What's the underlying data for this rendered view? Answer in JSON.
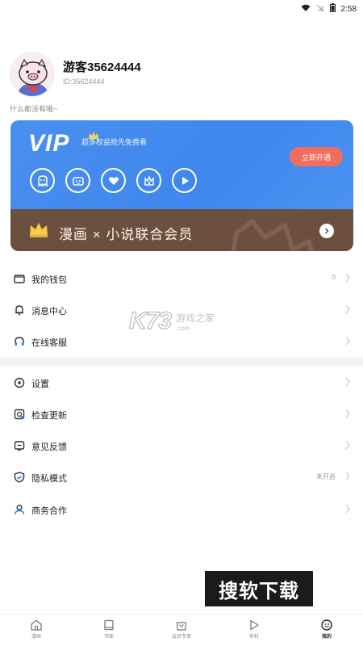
{
  "status_bar": {
    "time": "2:58"
  },
  "profile": {
    "username": "游客35624444",
    "user_id": "ID:35624444",
    "bio": "什么都没有哦~"
  },
  "vip": {
    "logo_text": "VIP",
    "description": "超多权益抢先免费看",
    "open_button": "立即开通",
    "perk_icons": [
      "ghost-icon",
      "id-card-icon",
      "heart-icon",
      "crown-cup-icon",
      "play-icon"
    ]
  },
  "union": {
    "title": "漫画 × 小说联合会员"
  },
  "menu": {
    "group1": [
      {
        "label": "我的钱包",
        "extra": "0",
        "icon": "wallet-icon"
      },
      {
        "label": "消息中心",
        "extra": "",
        "icon": "bell-icon"
      },
      {
        "label": "在线客服",
        "extra": "",
        "icon": "headset-icon"
      }
    ],
    "group2": [
      {
        "label": "设置",
        "extra": "",
        "icon": "settings-icon"
      },
      {
        "label": "检查更新",
        "extra": "",
        "icon": "update-icon"
      },
      {
        "label": "意见反馈",
        "extra": "",
        "icon": "feedback-icon"
      },
      {
        "label": "隐私模式",
        "extra": "未开启",
        "icon": "shield-icon"
      },
      {
        "label": "商务合作",
        "extra": "",
        "icon": "person-icon"
      }
    ]
  },
  "watermark": {
    "logo": "K73",
    "name": "游戏之家",
    "url": ".com"
  },
  "overlay_badge": "搜软下载",
  "tabs": [
    {
      "label": "漫画",
      "icon": "home-icon"
    },
    {
      "label": "书架",
      "icon": "bookshelf-icon"
    },
    {
      "label": "会员专享",
      "icon": "vip-bag-icon"
    },
    {
      "label": "有料",
      "icon": "play-icon"
    },
    {
      "label": "我的",
      "icon": "profile-icon",
      "active": true
    }
  ],
  "colors": {
    "vip_blue": "#4a8ff0",
    "union_brown": "#6b5040",
    "open_button": "#f26d5b"
  }
}
